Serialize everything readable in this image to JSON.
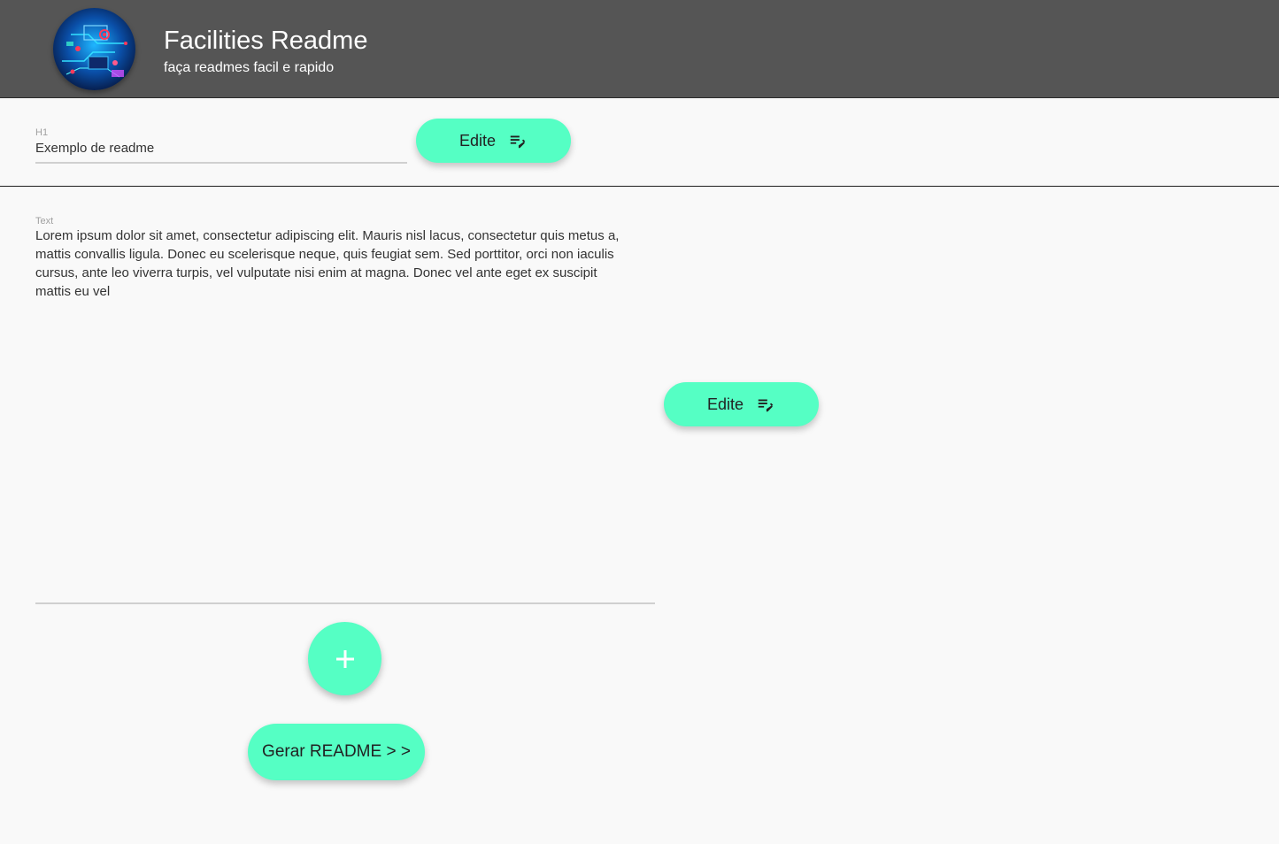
{
  "header": {
    "title": "Facilities Readme",
    "subtitle": "faça readmes facil e rapido",
    "logo_icon": "circuit-logo-icon"
  },
  "h1_field": {
    "label": "H1",
    "value": "Exemplo de readme",
    "edit_button_label": "Edite",
    "edit_icon": "edit-note-icon"
  },
  "text_field": {
    "label": "Text",
    "lines": [
      "Lorem ipsum dolor sit amet, consectetur adipiscing elit. Mauris nisl lacus, consectetur quis metus a,",
      "mattis convallis ligula. Donec eu scelerisque neque, quis feugiat sem. Sed porttitor, orci non iaculis",
      "cursus, ante leo viverra turpis, vel vulputate nisi enim at magna. Donec vel ante eget ex suscipit",
      "mattis eu vel"
    ],
    "edit_button_label": "Edite",
    "edit_icon": "edit-note-icon"
  },
  "add_button": {
    "icon": "plus-icon"
  },
  "generate_button": {
    "label": "Gerar README > >"
  },
  "colors": {
    "header_bg": "#555555",
    "accent": "#55ffc4",
    "page_bg": "#f9f9f9"
  }
}
